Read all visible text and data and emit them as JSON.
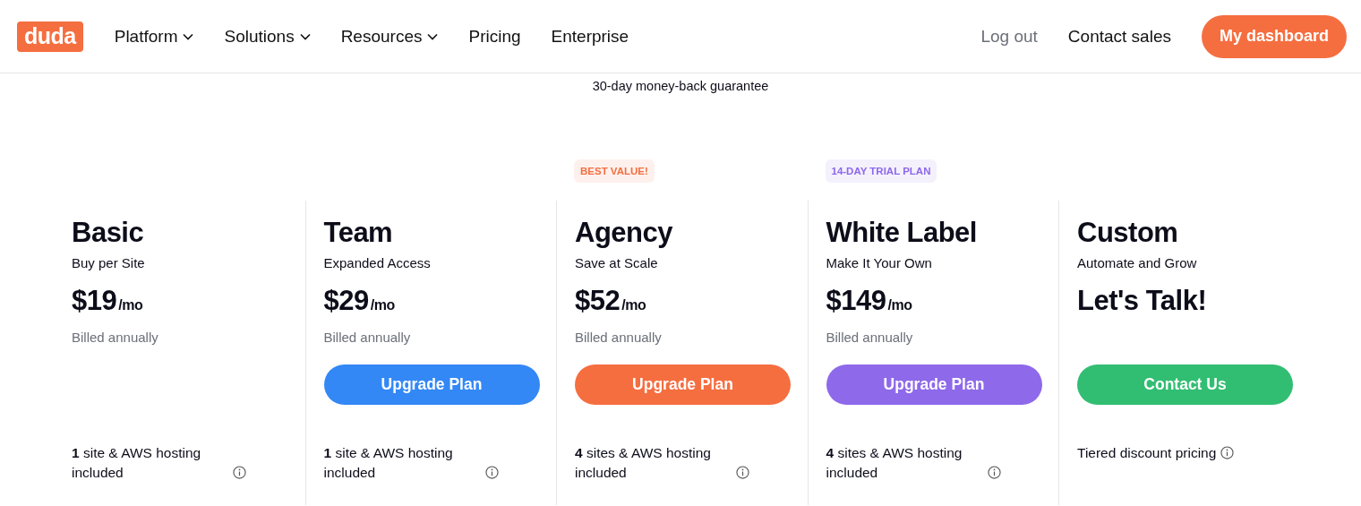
{
  "header": {
    "logo": "duda",
    "nav": [
      {
        "label": "Platform",
        "dropdown": true
      },
      {
        "label": "Solutions",
        "dropdown": true
      },
      {
        "label": "Resources",
        "dropdown": true
      },
      {
        "label": "Pricing",
        "dropdown": false
      },
      {
        "label": "Enterprise",
        "dropdown": false
      }
    ],
    "log_out": "Log out",
    "contact_sales": "Contact sales",
    "dashboard_button": "My dashboard"
  },
  "guarantee": "30-day money-back guarantee",
  "plans": [
    {
      "name": "Basic",
      "tagline": "Buy per Site",
      "price": "$19",
      "per": "/mo",
      "billing": "Billed annually",
      "feature": "**1** site & AWS hosting included"
    },
    {
      "name": "Team",
      "tagline": "Expanded Access",
      "price": "$29",
      "per": "/mo",
      "billing": "Billed annually",
      "button": {
        "label": "Upgrade Plan",
        "color": "#3388f5"
      },
      "feature": "**1** site & AWS hosting included"
    },
    {
      "name": "Agency",
      "tagline": "Save at Scale",
      "price": "$52",
      "per": "/mo",
      "billing": "Billed annually",
      "badge": {
        "label": "BEST VALUE!",
        "color": "#f56e40"
      },
      "button": {
        "label": "Upgrade Plan",
        "color": "#f56e40"
      },
      "feature": "**4** sites & AWS hosting included"
    },
    {
      "name": "White Label",
      "tagline": "Make It Your Own",
      "price": "$149",
      "per": "/mo",
      "billing": "Billed annually",
      "badge": {
        "label": "14-DAY TRIAL PLAN",
        "color": "#8d67ea"
      },
      "button": {
        "label": "Upgrade Plan",
        "color": "#8e69ea"
      },
      "feature": "**4** sites & AWS hosting included"
    },
    {
      "name": "Custom",
      "tagline": "Automate and Grow",
      "price": "Let's Talk!",
      "button": {
        "label": "Contact Us",
        "color": "#31be72"
      },
      "feature": "Tiered discount pricing"
    }
  ]
}
